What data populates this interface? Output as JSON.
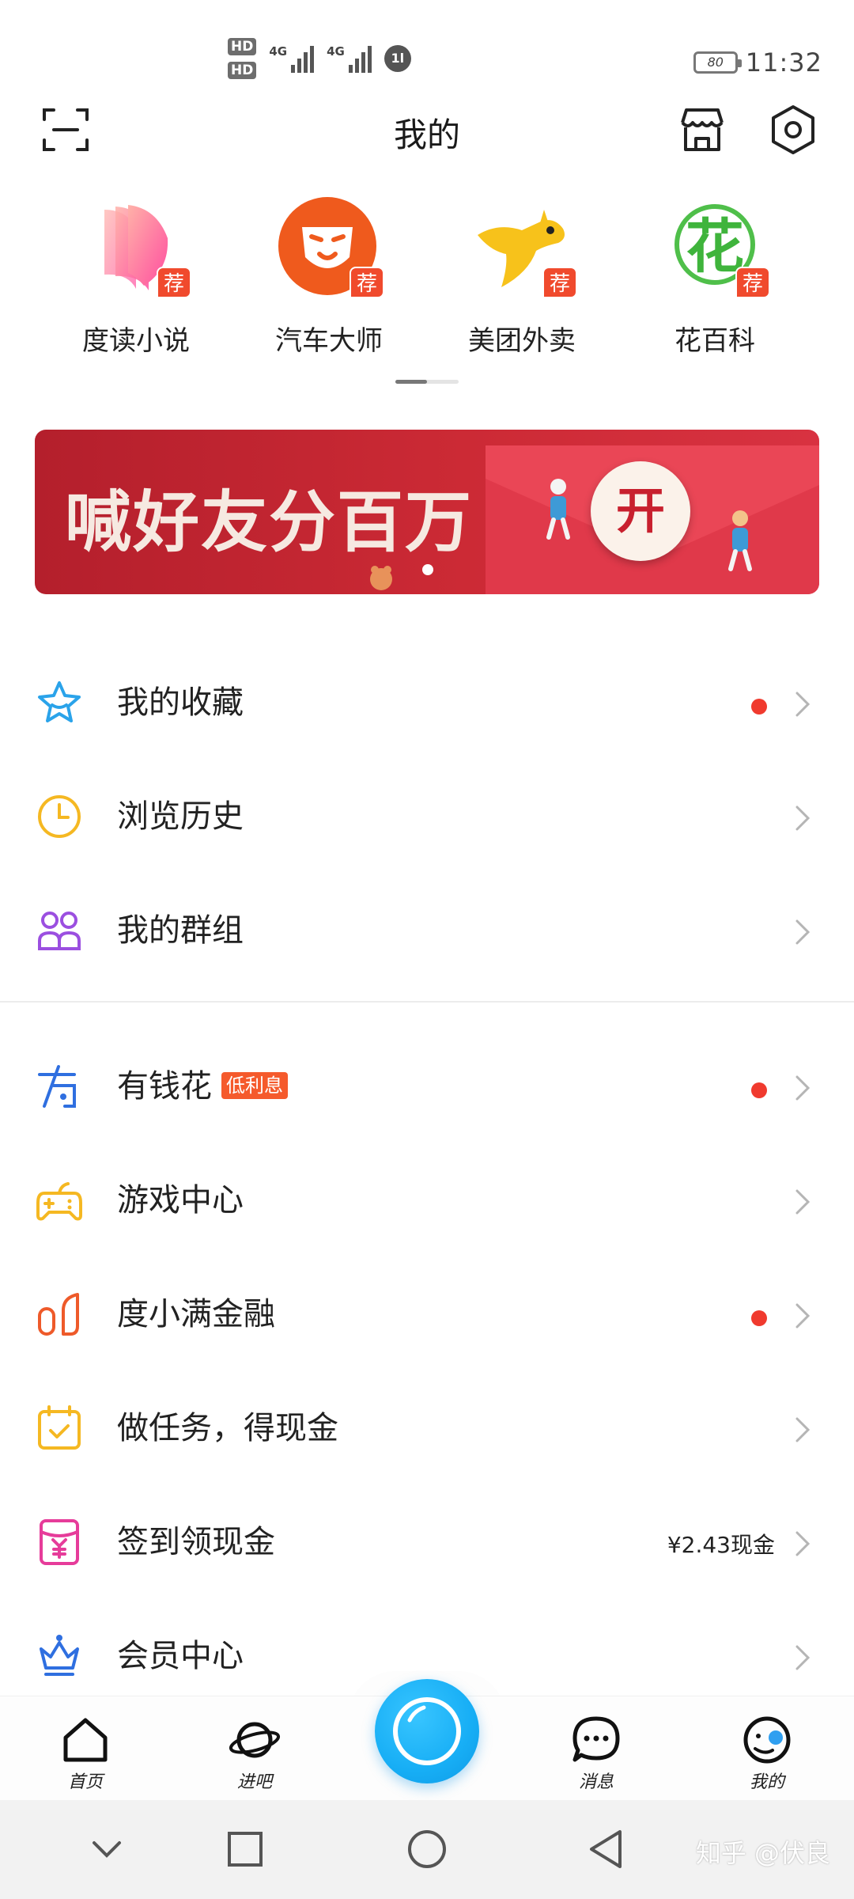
{
  "status_bar": {
    "hd1": "HD",
    "hd2": "HD",
    "net1": "4G",
    "net2": "4G",
    "data_icon": "1l",
    "battery": "80",
    "time": "11:32"
  },
  "header": {
    "title": "我的"
  },
  "apps": [
    {
      "label": "度读小说",
      "badge": "荐",
      "icon": "book-icon"
    },
    {
      "label": "汽车大师",
      "badge": "荐",
      "icon": "lion-icon"
    },
    {
      "label": "美团外卖",
      "badge": "荐",
      "icon": "kangaroo-icon"
    },
    {
      "label": "花百科",
      "badge": "荐",
      "icon": "flower-icon"
    }
  ],
  "banner": {
    "text": "喊好友分百万",
    "button": "开"
  },
  "menu": [
    {
      "label": "我的收藏",
      "dot": true,
      "icon": "star-icon",
      "color": "#2aa3ea"
    },
    {
      "label": "浏览历史",
      "dot": false,
      "icon": "clock-icon",
      "color": "#f5b822"
    },
    {
      "label": "我的群组",
      "dot": false,
      "icon": "group-icon",
      "color": "#9b4fe0"
    },
    {
      "label": "有钱花",
      "tag": "低利息",
      "dot": true,
      "icon": "money-icon",
      "color": "#2f6fe0"
    },
    {
      "label": "游戏中心",
      "dot": false,
      "icon": "gamepad-icon",
      "color": "#f5b822"
    },
    {
      "label": "度小满金融",
      "dot": true,
      "icon": "finance-icon",
      "color": "#ee5a2a"
    },
    {
      "label": "做任务，得现金",
      "dot": false,
      "icon": "task-calendar-icon",
      "color": "#f5b822"
    },
    {
      "label": "签到领现金",
      "note": "¥2.43现金",
      "dot": false,
      "icon": "cash-envelope-icon",
      "color": "#e63c9a"
    },
    {
      "label": "会员中心",
      "dot": false,
      "icon": "crown-icon",
      "color": "#2f6fe0"
    }
  ],
  "bottom_nav": [
    {
      "label": "首页",
      "icon": "home-icon"
    },
    {
      "label": "进吧",
      "icon": "planet-icon"
    },
    {
      "label": "",
      "icon": "camera-lens-icon"
    },
    {
      "label": "消息",
      "icon": "message-icon"
    },
    {
      "label": "我的",
      "icon": "profile-face-icon"
    }
  ],
  "watermark": "知乎 @伏良"
}
